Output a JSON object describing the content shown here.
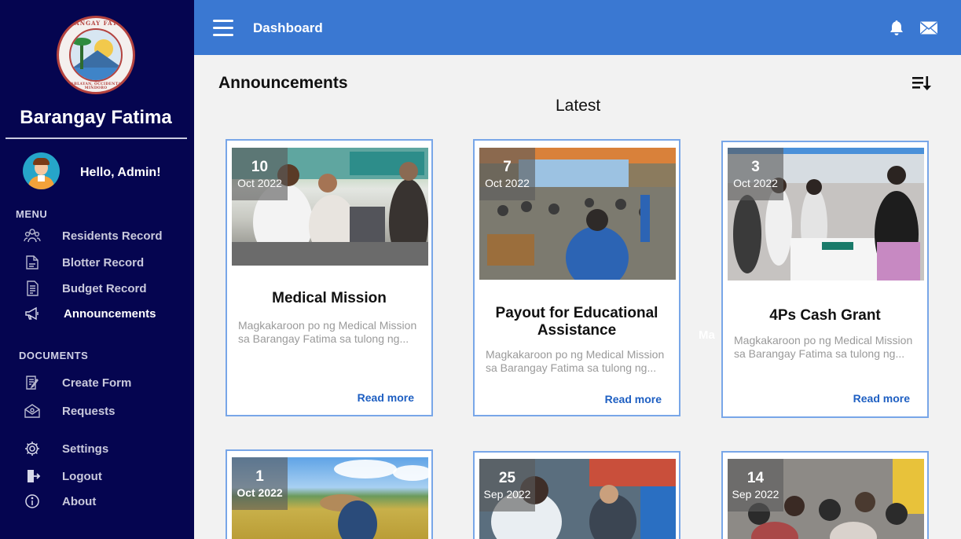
{
  "sidebar": {
    "brand": "Barangay Fatima",
    "logo": {
      "top_text": "BARANGAY FATIMA",
      "bottom_text": "SABLAYAN, OCCIDENTAL MINDORO"
    },
    "greeting": "Hello, Admin!",
    "menu_label": "MENU",
    "documents_label": "DOCUMENTS",
    "menu_items": [
      {
        "label": "Residents Record",
        "icon": "residents-icon"
      },
      {
        "label": "Blotter Record",
        "icon": "blotter-icon"
      },
      {
        "label": "Budget Record",
        "icon": "budget-icon"
      },
      {
        "label": "Announcements",
        "icon": "megaphone-icon",
        "active": true
      }
    ],
    "document_items": [
      {
        "label": "Create Form",
        "icon": "create-form-icon"
      },
      {
        "label": "Requests",
        "icon": "requests-icon"
      }
    ],
    "bottom_items": [
      {
        "label": "Settings",
        "icon": "gear-icon"
      },
      {
        "label": "Logout",
        "icon": "logout-icon"
      },
      {
        "label": "About",
        "icon": "info-icon"
      }
    ]
  },
  "header": {
    "title": "Dashboard"
  },
  "main": {
    "title": "Announcements",
    "subtitle": "Latest",
    "stray_text": "Ma",
    "cards": [
      {
        "day": "10",
        "month": "Oct 2022",
        "title": "Medical Mission",
        "description": "Magkakaroon po ng Medical Mission sa Barangay Fatima sa tulong ng...",
        "read_more": "Read more"
      },
      {
        "day": "7",
        "month": "Oct 2022",
        "title": "Payout for Educational Assistance",
        "description": "Magkakaroon po ng Medical Mission sa Barangay Fatima sa tulong ng...",
        "read_more": "Read more"
      },
      {
        "day": "3",
        "month": "Oct 2022",
        "title": "4Ps Cash Grant",
        "description": "Magkakaroon po ng Medical Mission sa Barangay Fatima sa tulong ng...",
        "read_more": "Read more"
      },
      {
        "day": "1",
        "month": "Oct 2022"
      },
      {
        "day": "25",
        "month": "Sep 2022"
      },
      {
        "day": "14",
        "month": "Sep 2022"
      }
    ]
  },
  "colors": {
    "sidebar_bg": "#050550",
    "header_bg": "#3a78d2",
    "card_border": "#78a6e8",
    "link": "#1e5fc2"
  }
}
